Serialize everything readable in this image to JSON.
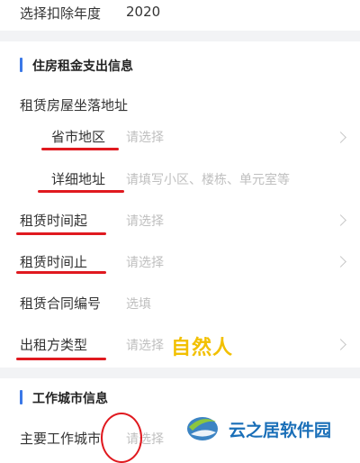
{
  "deduction_year": {
    "label": "选择扣除年度",
    "value": "2020"
  },
  "housing_section": {
    "title": "住房租金支出信息"
  },
  "rental_address": {
    "label": "租赁房屋坐落地址"
  },
  "province_city": {
    "label": "省市地区",
    "placeholder": "请选择"
  },
  "detail_address": {
    "label": "详细地址",
    "placeholder": "请填写小区、楼栋、单元室等"
  },
  "rent_start": {
    "label": "租赁时间起",
    "placeholder": "请选择"
  },
  "rent_end": {
    "label": "租赁时间止",
    "placeholder": "请选择"
  },
  "contract_no": {
    "label": "租赁合同编号",
    "placeholder": "选填"
  },
  "lessor_type": {
    "label": "出租方类型",
    "placeholder": "请选择",
    "annotation": "自然人"
  },
  "work_city_section": {
    "title": "工作城市信息"
  },
  "main_work_city": {
    "label": "主要工作城市",
    "placeholder": "请选择"
  },
  "watermark": {
    "text": "云之居软件园"
  },
  "colors": {
    "accent": "#3b78e7",
    "annotation_red": "#e0191f",
    "annotation_yellow": "#f2c000"
  }
}
